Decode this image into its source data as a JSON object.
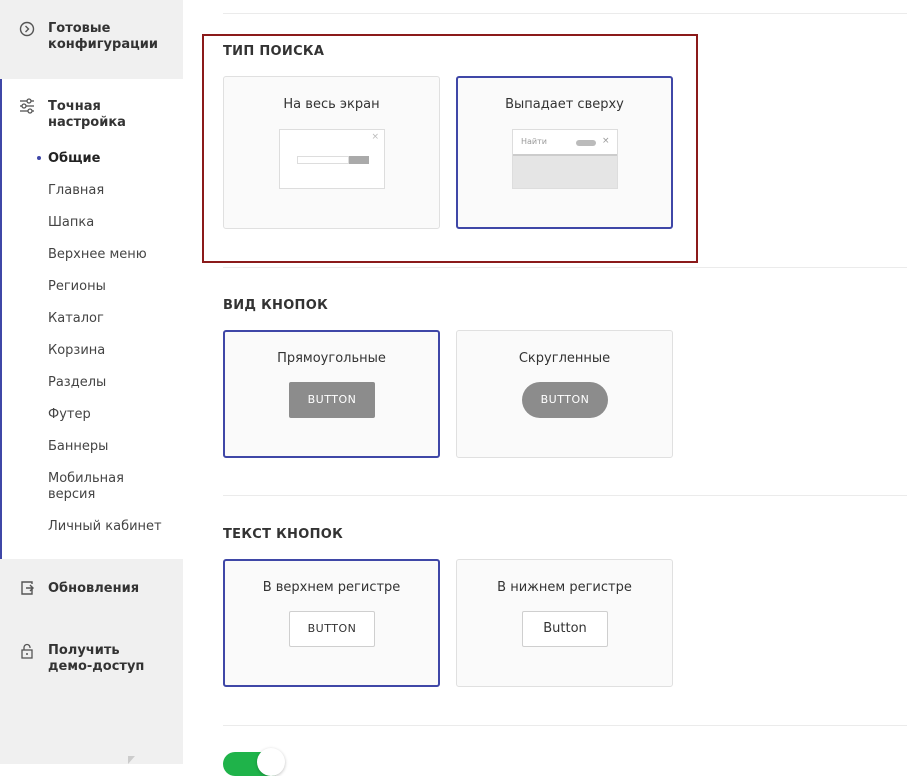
{
  "sidebar": {
    "ready_configs": "Готовые конфигурации",
    "fine_tune": "Точная настройка",
    "items": [
      {
        "label": "Общие"
      },
      {
        "label": "Главная"
      },
      {
        "label": "Шапка"
      },
      {
        "label": "Верхнее меню"
      },
      {
        "label": "Регионы"
      },
      {
        "label": "Каталог"
      },
      {
        "label": "Корзина"
      },
      {
        "label": "Разделы"
      },
      {
        "label": "Футер"
      },
      {
        "label": "Баннеры"
      },
      {
        "label": "Мобильная версия"
      },
      {
        "label": "Личный кабинет"
      }
    ],
    "updates": "Обновления",
    "demo": "Получить демо-доступ"
  },
  "search_type": {
    "title": "ТИП ПОИСКА",
    "option_fullscreen": "На весь экран",
    "option_dropdown": "Выпадает сверху",
    "dropdown_placeholder": "Найти",
    "close_glyph": "×"
  },
  "button_style": {
    "title": "ВИД КНОПОК",
    "option_rect": "Прямоугольные",
    "option_round": "Скругленные",
    "sample_label": "BUTTON"
  },
  "button_text": {
    "title": "ТЕКСТ КНОПОК",
    "option_upper": "В верхнем регистре",
    "option_lower": "В нижнем регистре",
    "sample_upper": "BUTTON",
    "sample_lower": "Button"
  },
  "colors": {
    "accent": "#3f47a7",
    "highlight_border": "#8b1a1a",
    "toggle_on": "#1fb34a",
    "sample_button": "#8c8c8c"
  }
}
